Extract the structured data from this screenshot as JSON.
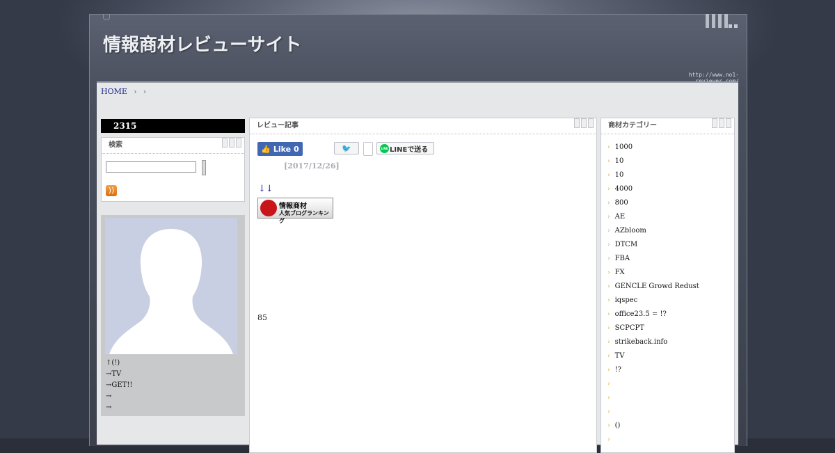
{
  "header": {
    "site_title": "情報商材レビューサイト",
    "site_url": "http://www.no1-reviewer.com/"
  },
  "breadcrumb": {
    "home": "HOME",
    "sep1": "›",
    "sep2": "›"
  },
  "left": {
    "counter": "2315",
    "search_title": "検索",
    "search_value": "",
    "rss_label": "))",
    "profile_lines": [
      "↑(!)",
      "→TV",
      "→GET!!",
      "→",
      "→"
    ]
  },
  "main": {
    "title": "レビュー記事",
    "fb_like": "👍 Like 0",
    "twitter": "🐦",
    "line_label": "LINEで送る",
    "line_logo": "LINE",
    "date": "[2017/12/26]",
    "arrows": "↓↓",
    "ranking_line1": "情報商材",
    "ranking_line2": "人気ブログランキング",
    "count": "85"
  },
  "right": {
    "title": "商材カテゴリー",
    "arrow": "›",
    "categories": [
      "1000",
      "10",
      "10",
      "4000",
      "800",
      "AE",
      "AZbloom",
      "DTCM",
      "FBA",
      "FX",
      "GENCLE Growd Redust",
      "iqspec",
      "office23.5 = !?",
      "SCPCPT",
      "strikeback.info",
      "TV",
      "!?",
      "",
      "",
      "",
      "()",
      ""
    ]
  }
}
